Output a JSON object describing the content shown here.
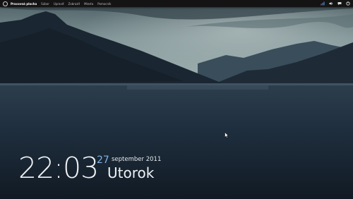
{
  "panel": {
    "menu": [
      {
        "label": "Pracovná plocha"
      },
      {
        "label": "Súbor"
      },
      {
        "label": "Upraviť"
      },
      {
        "label": "Zobraziť"
      },
      {
        "label": "Miesta"
      },
      {
        "label": "Pomocník"
      }
    ],
    "tray_icons": [
      "network-icon",
      "volume-icon",
      "messaging-icon",
      "settings-icon"
    ]
  },
  "clock": {
    "time": "22:03",
    "day": "27",
    "month_year": "september 2011",
    "weekday": "Utorok"
  },
  "colors": {
    "accent": "#7fb2e6",
    "panel": "#141414"
  }
}
